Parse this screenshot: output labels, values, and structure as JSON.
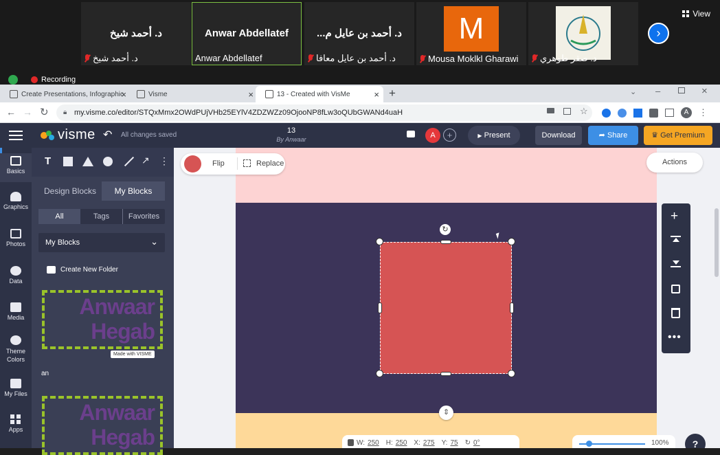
{
  "zoom": {
    "participants": [
      {
        "big": "د. أحمد شيخ",
        "name": "د. أحمد شيخ",
        "muted": true
      },
      {
        "big": "Anwar Abdellatef",
        "name": "Anwar Abdellatef",
        "muted": false
      },
      {
        "big": "...د. أحمد بن عايل م",
        "name": "د. أحمد بن عايل معافا",
        "muted": true
      },
      {
        "big": "M",
        "name": "Mousa Moklkl Gharawi",
        "muted": true,
        "color": "#e8670c"
      },
      {
        "big": "",
        "name": "د. صقر طوهري",
        "muted": true
      }
    ],
    "view_label": "View",
    "recording": "Recording"
  },
  "browser": {
    "tabs": [
      "Create Presentations, Infographic",
      "Visme",
      "13 - Created with VisMe"
    ],
    "url": "my.visme.co/editor/STQxMmx2OWdPUjVHb25EYlV4ZDZWZz09OjooNP8fLw3oQUbGWANd4uaH",
    "profile": "A"
  },
  "app": {
    "logo": "visme",
    "saved": "All changes saved",
    "doc_title": "13",
    "doc_author": "By Anwaar",
    "avatar": "A",
    "present": "Present",
    "download": "Download",
    "share": "Share",
    "premium": "Get Premium"
  },
  "nav": [
    "Basics",
    "Graphics",
    "Photos",
    "Data",
    "Media",
    "Theme Colors",
    "My Files",
    "Apps"
  ],
  "panel": {
    "tab_design": "Design Blocks",
    "tab_mine": "My Blocks",
    "filter_all": "All",
    "filter_tags": "Tags",
    "filter_fav": "Favorites",
    "dropdown": "My Blocks",
    "new_folder": "Create New Folder",
    "block_text_1": "Anwaar",
    "block_text_2": "Hegab",
    "made_with": "Made with VISME",
    "block_name": "an"
  },
  "toolbar": {
    "flip": "Flip",
    "replace": "Replace",
    "actions": "Actions",
    "fill_color": "#d65454"
  },
  "status": {
    "w_label": "W:",
    "w": "250",
    "h_label": "H:",
    "h": "250",
    "x_label": "X:",
    "x": "275",
    "y_label": "Y:",
    "y": "75",
    "rot": "0°",
    "zoom": "100%",
    "help": "?"
  },
  "colors": {
    "slide_top": "#fdd3d3",
    "slide_main": "#3c3459",
    "slide_bottom": "#fed999",
    "shape": "#d65454",
    "accent_premium": "#f5a623",
    "share": "#3d8fe5"
  }
}
